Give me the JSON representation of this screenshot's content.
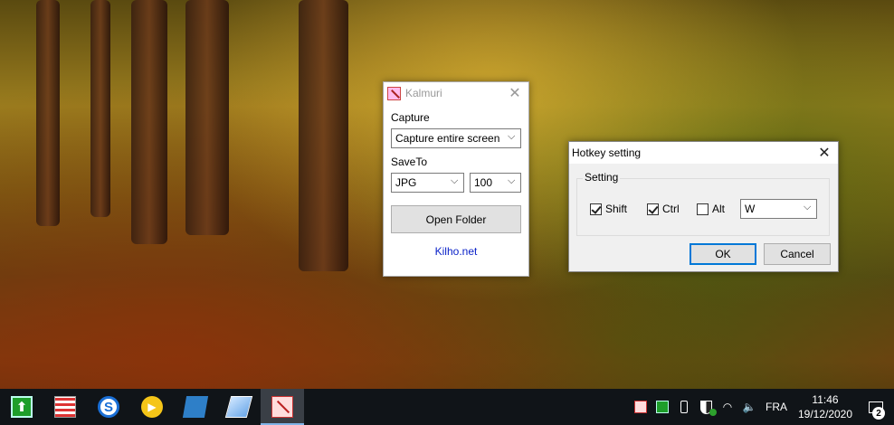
{
  "kalmuri": {
    "title": "Kalmuri",
    "capture_label": "Capture",
    "capture_value": "Capture entire screen",
    "saveto_label": "SaveTo",
    "format_value": "JPG",
    "quality_value": "100",
    "open_folder_label": "Open Folder",
    "link_text": "Kilho.net"
  },
  "hotkey": {
    "title": "Hotkey setting",
    "group_label": "Setting",
    "shift": {
      "label": "Shift",
      "checked": true
    },
    "ctrl": {
      "label": "Ctrl",
      "checked": true
    },
    "alt": {
      "label": "Alt",
      "checked": false
    },
    "key_value": "W",
    "ok_label": "OK",
    "cancel_label": "Cancel"
  },
  "taskbar": {
    "apps": [
      {
        "name": "green-up-arrow-app",
        "active": false
      },
      {
        "name": "spreadsheet-app",
        "active": false
      },
      {
        "name": "s-circle-app",
        "active": false
      },
      {
        "name": "media-player-app",
        "active": false
      },
      {
        "name": "sticky-notes-app",
        "active": false
      },
      {
        "name": "glass-app",
        "active": false
      },
      {
        "name": "kalmuri-app",
        "active": true
      }
    ],
    "language": "FRA",
    "time": "11:46",
    "date": "19/12/2020",
    "notification_count": "2"
  },
  "colors": {
    "accent": "#0078d7",
    "link": "#0b22c8",
    "taskbar": "#101418"
  }
}
